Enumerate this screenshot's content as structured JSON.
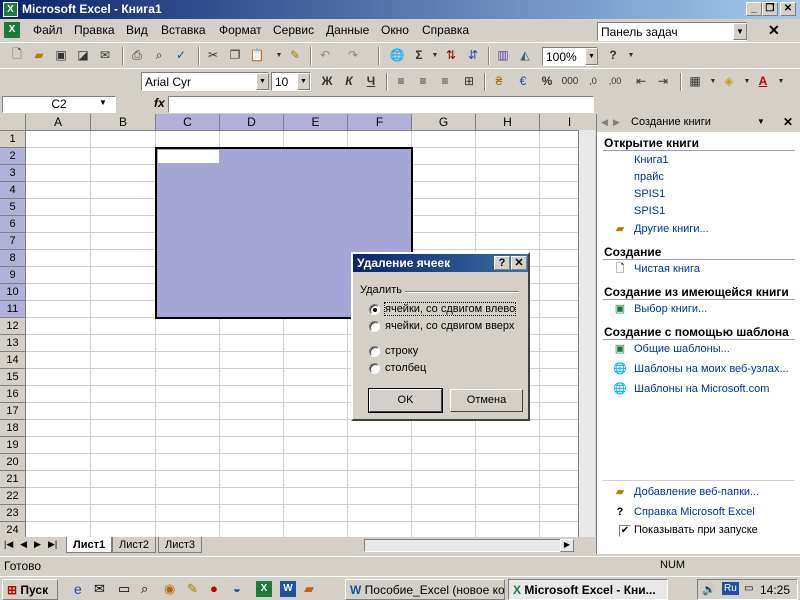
{
  "app": {
    "title": "Microsoft Excel - Книга1",
    "icon": "excel-icon"
  },
  "window_buttons": {
    "minimize": "_",
    "restore": "❐",
    "close": "✕"
  },
  "menu": [
    "Файл",
    "Правка",
    "Вид",
    "Вставка",
    "Формат",
    "Сервис",
    "Данные",
    "Окно",
    "Справка"
  ],
  "task_combo": "Панель задач",
  "toolbar": {
    "zoom": "100%",
    "font": "Arial Cyr",
    "size": "10",
    "bold": "Ж",
    "italic": "К",
    "underline": "Ч",
    "sigma": "Σ",
    "percent": "%",
    "thousands": "000",
    "currency": "₴"
  },
  "formula": {
    "cell": "C2",
    "fx": "fx",
    "value": ""
  },
  "grid": {
    "columns": [
      "A",
      "B",
      "C",
      "D",
      "E",
      "F",
      "G",
      "H",
      "I"
    ],
    "rows": [
      "1",
      "2",
      "3",
      "4",
      "5",
      "6",
      "7",
      "8",
      "9",
      "10",
      "11",
      "12",
      "13",
      "14",
      "15",
      "16",
      "17",
      "18",
      "19",
      "20",
      "21",
      "22",
      "23",
      "24"
    ],
    "active_cell": "C2",
    "selection": "C2:F11"
  },
  "sheets": {
    "tabs": [
      "Лист1",
      "Лист2",
      "Лист3"
    ],
    "active": "Лист1"
  },
  "status": {
    "left": "Готово",
    "num": "NUM"
  },
  "pane": {
    "title": "Создание книги",
    "open_heading": "Открытие книги",
    "open_items": [
      "Книга1",
      "прайс",
      "SPIS1",
      "SPIS1"
    ],
    "more_books": "Другие книги...",
    "create_heading": "Создание",
    "blank": "Чистая книга",
    "from_existing_heading": "Создание из имеющейся книги",
    "choose_book": "Выбор книги...",
    "template_heading": "Создание с помощью шаблона",
    "templates": [
      "Общие шаблоны...",
      "Шаблоны на моих веб-узлах...",
      "Шаблоны на Microsoft.com"
    ],
    "add_web_folder": "Добавление веб-папки...",
    "help": "Справка Microsoft Excel",
    "show_on_start": "Показывать при запуске",
    "show_on_start_checked": true
  },
  "dialog": {
    "title": "Удаление ячеек",
    "help_btn": "?",
    "close_btn": "✕",
    "group": "Удалить",
    "options": [
      "ячейки, со сдвигом влево",
      "ячейки, со сдвигом вверх",
      "строку",
      "столбец"
    ],
    "selected_option": "ячейки, со сдвигом влево",
    "ok": "OK",
    "cancel": "Отмена"
  },
  "taskbar": {
    "start": "Пуск",
    "tasks": [
      "Пособие_Excel (новое ко...",
      "Microsoft Excel - Кни..."
    ],
    "active_task": "Microsoft Excel - Кни...",
    "lang": "Ru",
    "time": "14:25"
  },
  "colors": {
    "title_bar": "#0a246a",
    "selection": "#a6a6d6",
    "link": "#0033a0",
    "window": "#d4d0c8"
  }
}
